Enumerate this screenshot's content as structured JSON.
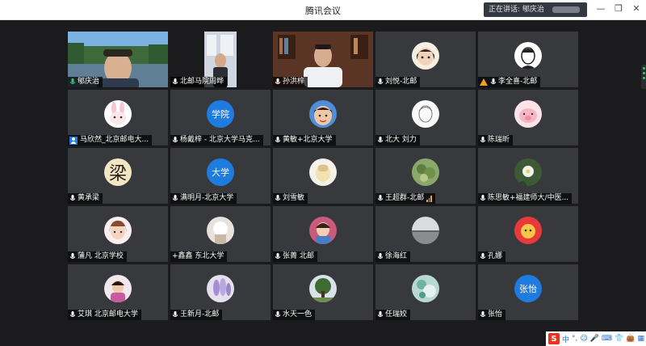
{
  "window": {
    "title": "腾讯会议",
    "speaking_label": "正在讲话: 郇庆治",
    "minimize": "—",
    "restore": "❐",
    "close": "✕"
  },
  "participants": [
    {
      "name": "郇庆治"
    },
    {
      "name": "北邮马院周晔"
    },
    {
      "name": "孙洪梓"
    },
    {
      "name": "刘悦-北邮"
    },
    {
      "name": "李全喜-北邮"
    },
    {
      "name": "马欣然_北京邮电大..."
    },
    {
      "name": "杨戴梓 - 北京大学马克..."
    },
    {
      "name": "黄敏+北京大学"
    },
    {
      "name": "北大 刘力"
    },
    {
      "name": "陈瑞昕"
    },
    {
      "name": "黄承梁"
    },
    {
      "name": "满明月-北京大学",
      "avatar_text": "大学"
    },
    {
      "name": "刘雪敏"
    },
    {
      "name": "王超群-北邮"
    },
    {
      "name": "陈思敏+福建师大/中医..."
    },
    {
      "name": "蒲凡 北京学校"
    },
    {
      "name": "+鑫鑫 东北大学"
    },
    {
      "name": "张菁 北邮"
    },
    {
      "name": "徐海红"
    },
    {
      "name": "孔娜"
    },
    {
      "name": "艾琪 北京邮电大学"
    },
    {
      "name": "王新月-北邮"
    },
    {
      "name": "水天一色"
    },
    {
      "name": "任瑞姣"
    },
    {
      "name": "张怡",
      "avatar_text": "张怡"
    }
  ],
  "avatar_labels": {
    "t6": "学院",
    "t10": "梁"
  },
  "ime": {
    "logo": "S",
    "lang": "中",
    "punct": "°,",
    "icons": [
      "☺",
      "🎤",
      "⌨",
      "👕",
      "👜",
      "▦"
    ]
  },
  "colors": {
    "accent_blue": "#1e7be0",
    "active_green": "#3ec46d",
    "tile_bg": "#38393d"
  }
}
